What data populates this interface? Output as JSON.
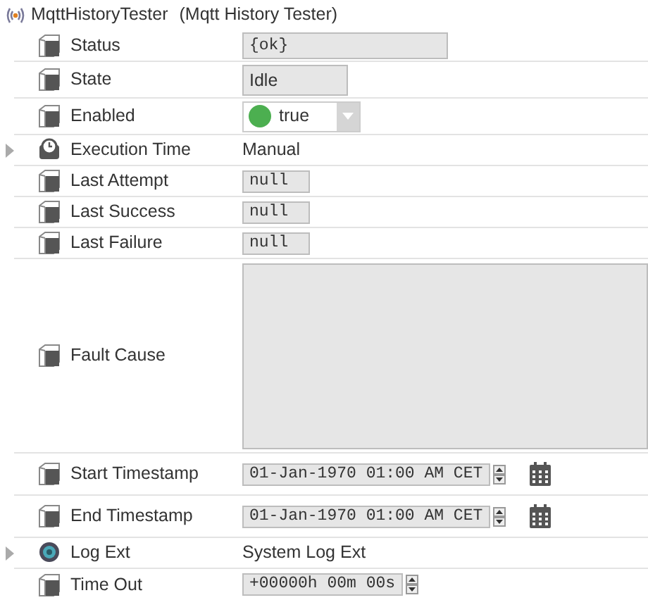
{
  "header": {
    "name": "MqttHistoryTester",
    "display_name": "(Mqtt History Tester)"
  },
  "properties": [
    {
      "label": "Status",
      "kind": "property",
      "value": {
        "kind": "wide-field",
        "text": "{ok}"
      }
    },
    {
      "label": "State",
      "kind": "property",
      "value": {
        "kind": "short-field",
        "text": "Idle"
      }
    },
    {
      "label": "Enabled",
      "kind": "property",
      "value": {
        "kind": "dropdown",
        "text": "true"
      }
    },
    {
      "label": "Execution Time",
      "kind": "action",
      "expanded": false,
      "value": {
        "kind": "plain",
        "text": "Manual"
      }
    },
    {
      "label": "Last Attempt",
      "kind": "property",
      "value": {
        "kind": "null-field",
        "text": "null"
      }
    },
    {
      "label": "Last Success",
      "kind": "property",
      "value": {
        "kind": "null-field",
        "text": "null"
      }
    },
    {
      "label": "Last Failure",
      "kind": "property",
      "value": {
        "kind": "null-field",
        "text": "null"
      }
    },
    {
      "label": "Fault Cause",
      "kind": "property",
      "value": {
        "kind": "textarea"
      }
    },
    {
      "label": "Start Timestamp",
      "kind": "property",
      "value": {
        "kind": "timestamp",
        "text": "01-Jan-1970 01:00 AM CET"
      }
    },
    {
      "label": "End Timestamp",
      "kind": "property",
      "value": {
        "kind": "timestamp",
        "text": "01-Jan-1970 01:00 AM CET"
      }
    },
    {
      "label": "Log Ext",
      "kind": "extension",
      "expanded": false,
      "value": {
        "kind": "plain",
        "text": "System Log Ext"
      }
    },
    {
      "label": "Time Out",
      "kind": "property",
      "value": {
        "kind": "duration",
        "text": "+00000h 00m 00s"
      }
    }
  ]
}
